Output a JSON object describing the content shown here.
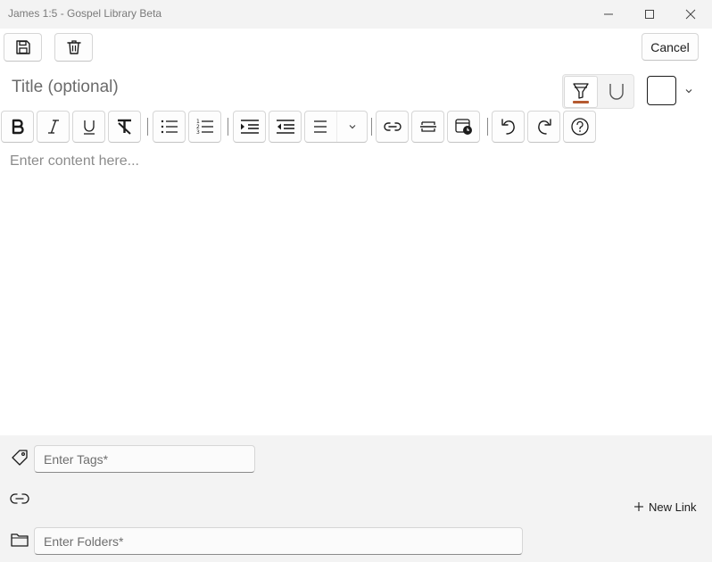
{
  "window": {
    "title": "James 1:5 - Gospel Library Beta"
  },
  "toolbar": {
    "cancel_label": "Cancel"
  },
  "editor": {
    "title_placeholder": "Title (optional)",
    "content_placeholder": "Enter content here...",
    "highlight_color": "#b55a30"
  },
  "fields": {
    "tags_placeholder": "Enter Tags*",
    "folders_placeholder": "Enter Folders*",
    "new_link_label": "New Link"
  },
  "icons": {
    "save": "save-icon",
    "delete": "trash-icon",
    "bold": "bold-icon",
    "italic": "italic-icon",
    "underline": "underline-icon",
    "clear_format": "clear-format-icon",
    "bullets": "bulleted-list-icon",
    "numbers": "numbered-list-icon",
    "indent": "indent-icon",
    "outdent": "outdent-icon",
    "align": "align-icon",
    "link": "link-icon",
    "horizontal_rule": "horizontal-rule-icon",
    "date": "calendar-clock-icon",
    "undo": "undo-icon",
    "redo": "redo-icon",
    "help": "help-icon",
    "tag": "tag-icon",
    "folder": "folder-icon"
  }
}
